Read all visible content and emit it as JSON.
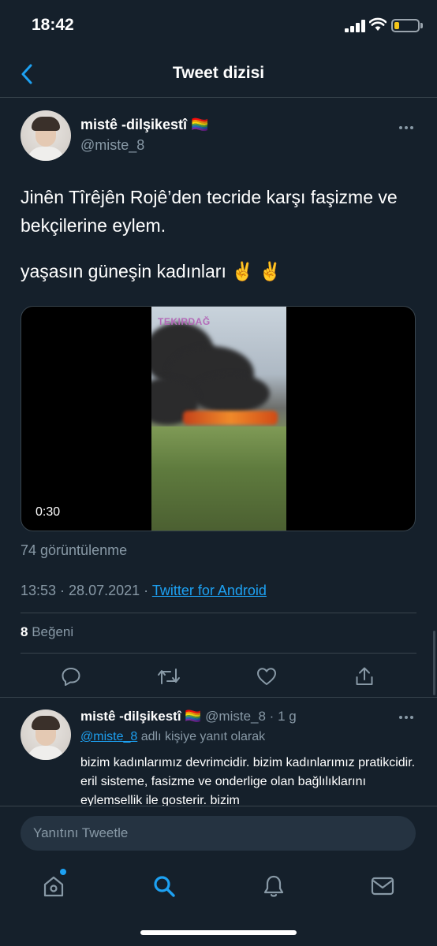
{
  "status_bar": {
    "time": "18:42",
    "battery_level": 0.2,
    "battery_color": "#f5c518"
  },
  "header": {
    "title": "Tweet dizisi",
    "back_icon": "chevron-left-icon"
  },
  "main_tweet": {
    "author_name": "mistê -dilşikestî 🏳️‍🌈",
    "handle": "@miste_8",
    "text_line1": "Jinên Tîrêjên Rojê’den tecride karşı faşizme ve bekçilerine eylem.",
    "text_line2": "yaşasın güneşin kadınları ✌️ ✌️",
    "video_label": "TEKIRDAĞ",
    "video_duration": "0:30",
    "views": "74 görüntülenme",
    "timestamp": "13:53 · 28.07.2021 · ",
    "source": "Twitter for Android",
    "likes_count": "8",
    "likes_label": " Beğeni"
  },
  "actions": [
    "reply-icon",
    "retweet-icon",
    "like-icon",
    "share-icon"
  ],
  "reply": {
    "author_name": "mistê -dilşikestî 🏳️‍🌈",
    "handle_time": " @miste_8 · 1 g",
    "mention": "@miste_8",
    "reply_to_suffix": " adlı kişiye yanıt olarak",
    "text": "bizim kadınlarımız devrimcidir. bizim kadınlarımız pratikcidir. eril sisteme, fasizme ve onderlige olan bağlılıklarını eylemsellik ile gosterir. bizim"
  },
  "compose": {
    "placeholder": "Yanıtını Tweetle"
  },
  "tabbar": {
    "tabs": [
      "home-icon",
      "search-icon",
      "notifications-icon",
      "messages-icon"
    ],
    "active": "search-icon",
    "accent": "#1da1f2"
  }
}
